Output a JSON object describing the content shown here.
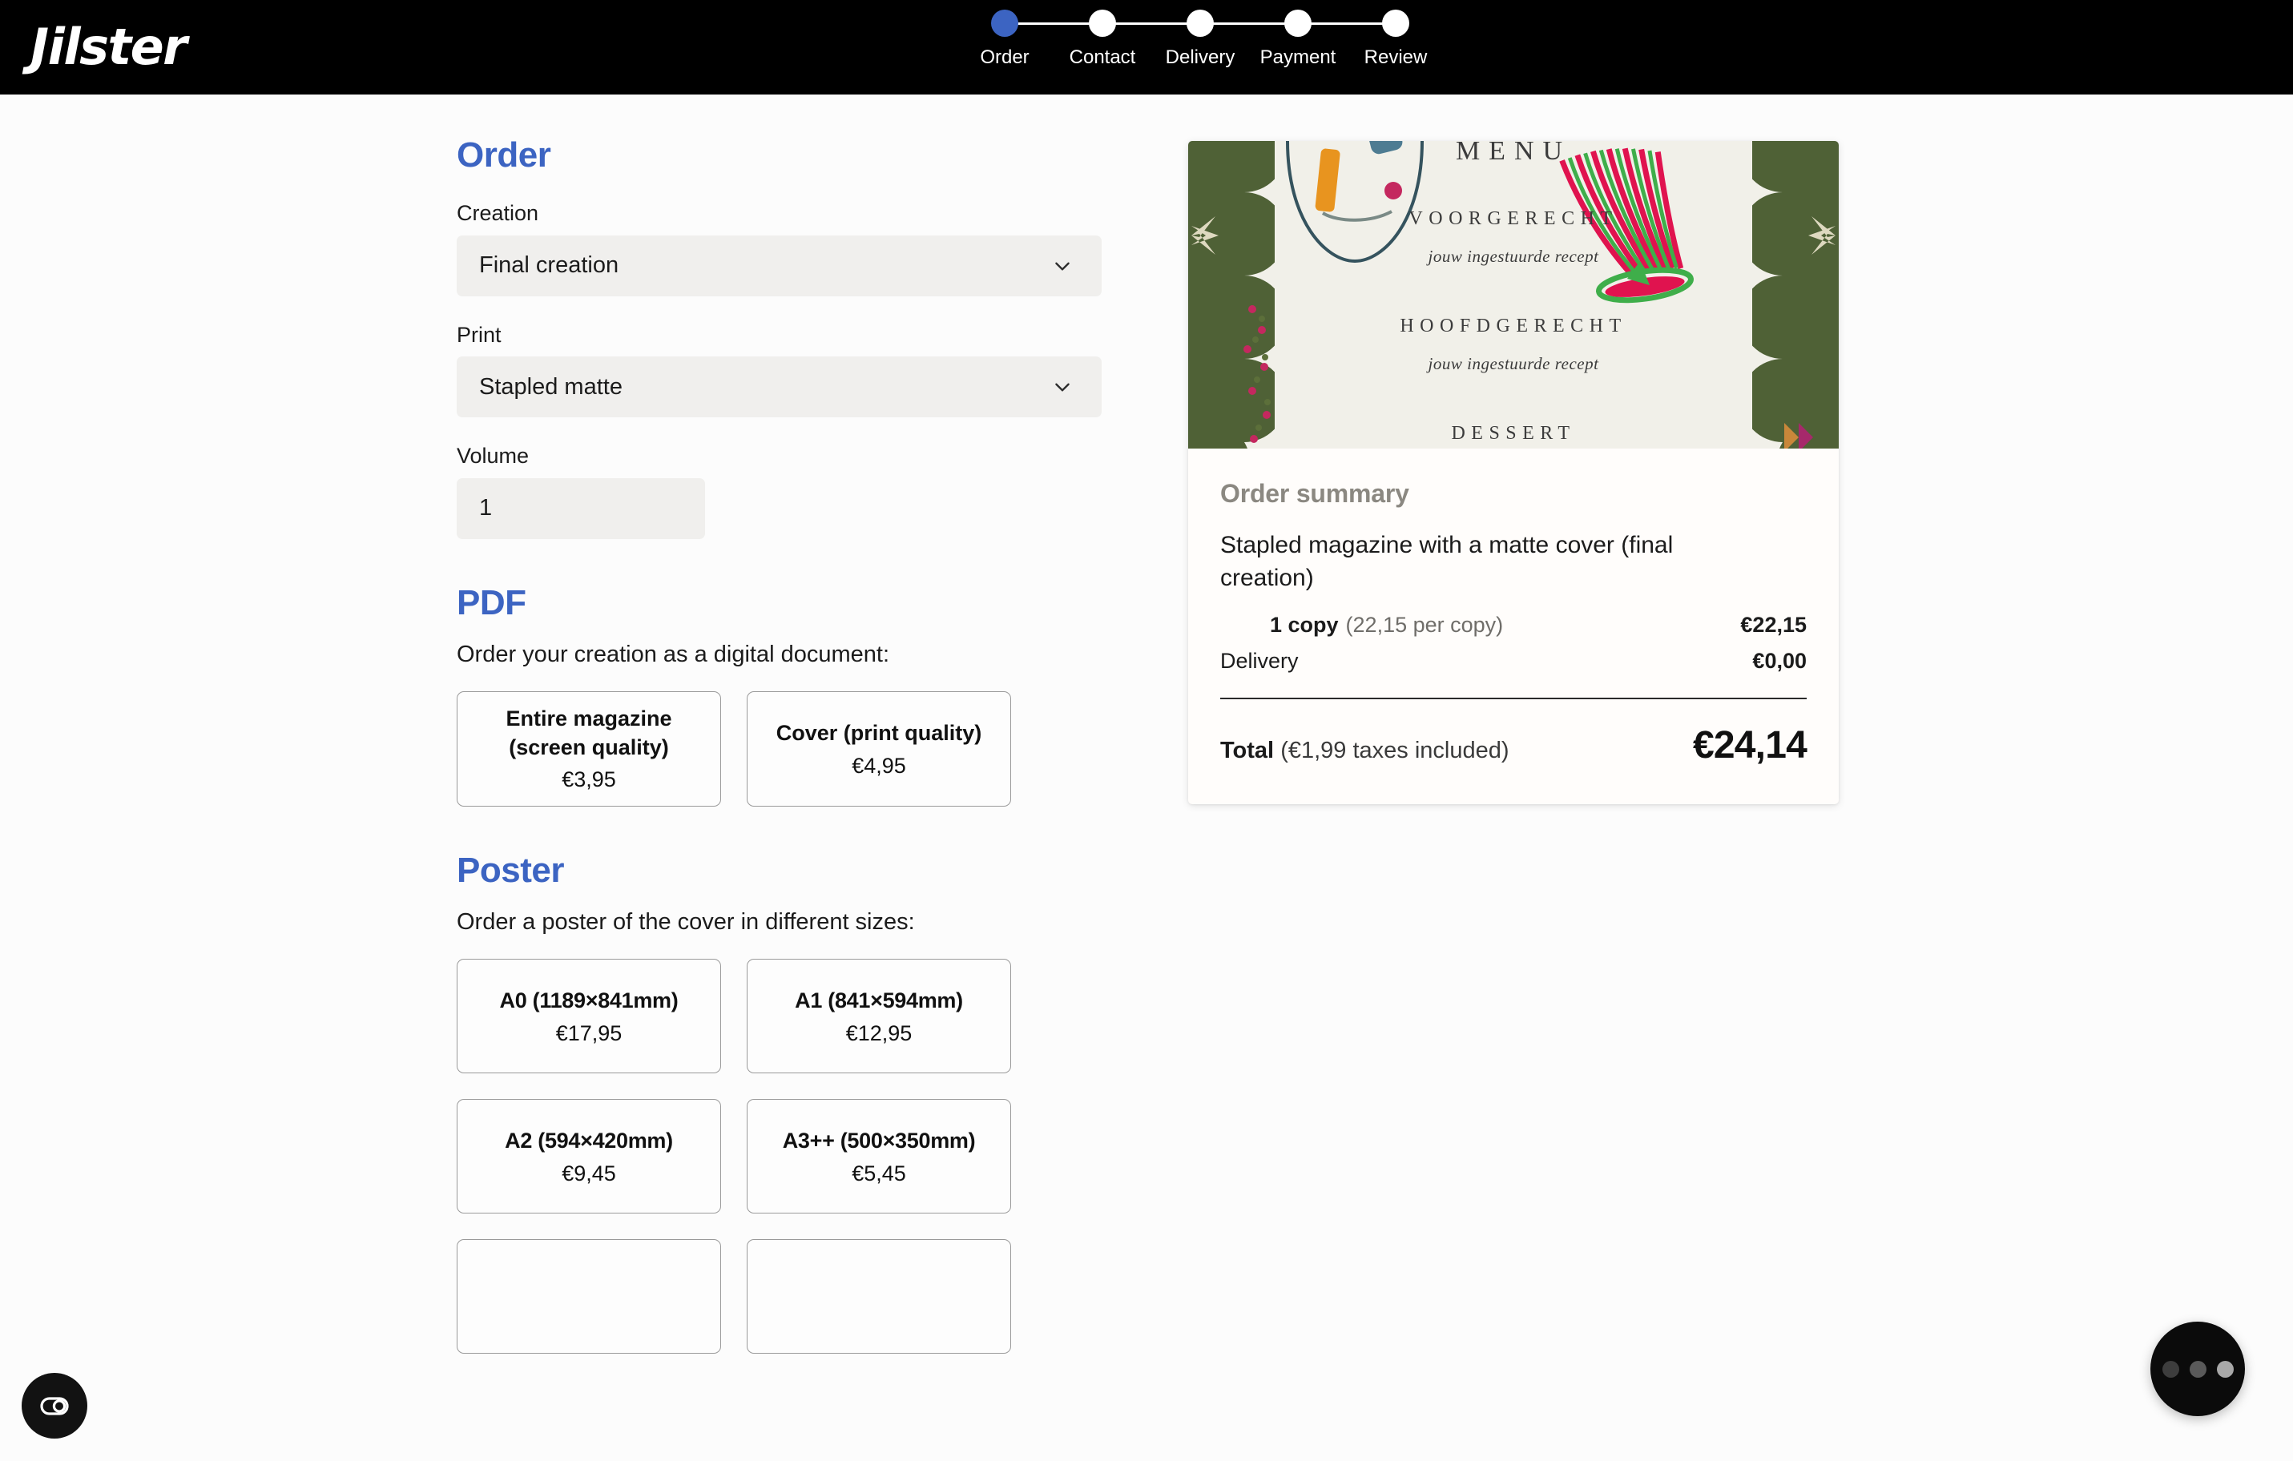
{
  "brand": {
    "name": "Jilster"
  },
  "stepper": {
    "active_index": 0,
    "active_color": "#3c64c2",
    "steps": [
      {
        "label": "Order"
      },
      {
        "label": "Contact"
      },
      {
        "label": "Delivery"
      },
      {
        "label": "Payment"
      },
      {
        "label": "Review"
      }
    ]
  },
  "order": {
    "heading": "Order",
    "creation": {
      "label": "Creation",
      "value": "Final creation"
    },
    "print": {
      "label": "Print",
      "value": "Stapled matte"
    },
    "volume": {
      "label": "Volume",
      "value": "1",
      "placeholder": "1"
    }
  },
  "pdf": {
    "heading": "PDF",
    "description": "Order your creation as a digital document:",
    "options": [
      {
        "title": "Entire magazine (screen quality)",
        "price": "€3,95"
      },
      {
        "title": "Cover (print quality)",
        "price": "€4,95"
      }
    ]
  },
  "poster": {
    "heading": "Poster",
    "description": "Order a poster of the cover in different sizes:",
    "options": [
      {
        "title": "A0 (1189×841mm)",
        "price": "€17,95"
      },
      {
        "title": "A1 (841×594mm)",
        "price": "€12,95"
      },
      {
        "title": "A2 (594×420mm)",
        "price": "€9,45"
      },
      {
        "title": "A3++ (500×350mm)",
        "price": "€5,45"
      }
    ]
  },
  "preview": {
    "menu_title": "MENU",
    "lines": [
      {
        "course": "VOORGERECHT",
        "subtitle": "jouw ingestuurde recept"
      },
      {
        "course": "HOOFDGERECHT",
        "subtitle": "jouw ingestuurde recept"
      },
      {
        "course": "DESSERT",
        "subtitle": ""
      }
    ],
    "colors": {
      "paper": "#f1f0e9",
      "green": "#4f6136",
      "berry": "#c4285f",
      "orange": "#e08a2e"
    }
  },
  "summary": {
    "title": "Order summary",
    "product": "Stapled magazine with a matte cover (final creation)",
    "line_items": [
      {
        "qty_label": "1 copy",
        "per_copy": "(22,15 per copy)",
        "amount": "€22,15"
      }
    ],
    "delivery": {
      "label": "Delivery",
      "amount": "€0,00"
    },
    "total": {
      "label": "Total",
      "taxes": "(€1,99 taxes included)",
      "amount": "€24,14"
    }
  },
  "widgets": {
    "accessibility": "accessibility-toggle",
    "chat": "chat-launcher"
  }
}
